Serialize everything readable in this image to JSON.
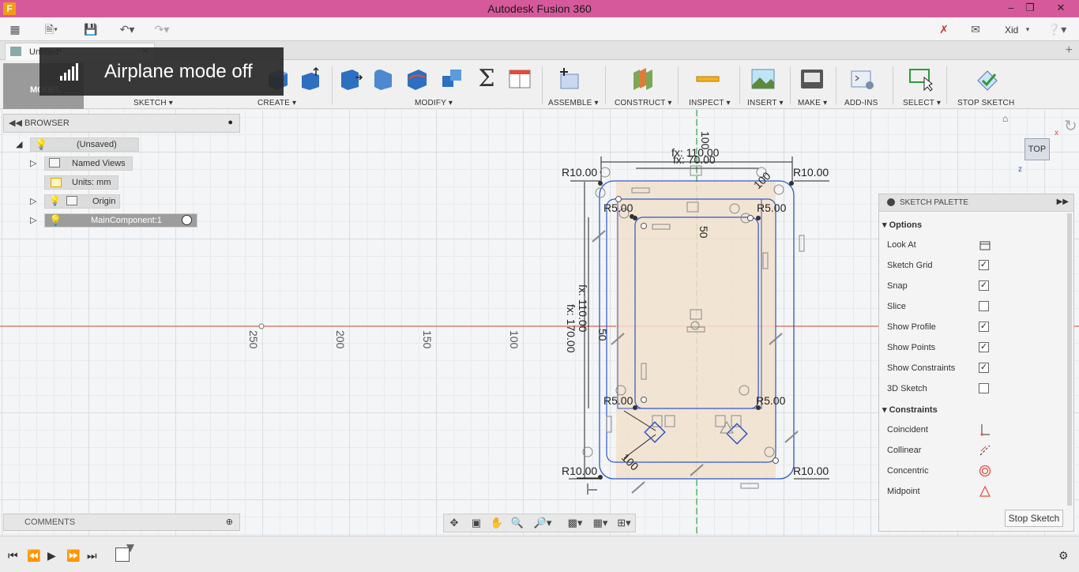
{
  "window": {
    "title": "Autodesk Fusion 360",
    "icon_letter": "F"
  },
  "appbar": {
    "user": "Xid"
  },
  "tab": {
    "name": "Untitled*"
  },
  "toast": {
    "text": "Airplane mode off"
  },
  "workspace": {
    "label": "MODEL"
  },
  "toolbar": {
    "groups": [
      "SKETCH ▾",
      "CREATE ▾",
      "MODIFY ▾",
      "ASSEMBLE ▾",
      "CONSTRUCT ▾",
      "INSPECT ▾",
      "INSERT ▾",
      "MAKE ▾",
      "ADD-INS",
      "SELECT ▾",
      "STOP SKETCH"
    ]
  },
  "browser": {
    "title": "BROWSER",
    "items": [
      {
        "label": "(Unsaved)"
      },
      {
        "label": "Named Views"
      },
      {
        "label": "Units: mm"
      },
      {
        "label": "Origin"
      },
      {
        "label": "MainComponent:1"
      }
    ]
  },
  "comments": {
    "title": "COMMENTS"
  },
  "viewcube": {
    "label": "TOP"
  },
  "sketch": {
    "dims": {
      "fx110_top": "fx: 110.00",
      "fx70_top": "fx: 70.00",
      "fx110_side": "fx: 110.00",
      "fx170_side": "fx: 170.00",
      "r10_tl": "R10.00",
      "r10_tr": "R10.00",
      "r10_bl": "R10.00",
      "r10_br": "R10.00",
      "r5_tl": "R5.00",
      "r5_tr": "R5.00",
      "r5_bl": "R5.00",
      "r5_br": "R5.00",
      "d100v": "100",
      "d50a": "50",
      "d50b": "50",
      "d100diag": "100",
      "d100diag2": "100"
    },
    "ruler": [
      "250",
      "200",
      "150",
      "100"
    ]
  },
  "palette": {
    "title": "SKETCH PALETTE",
    "options_title": "Options",
    "options": [
      {
        "label": "Look At",
        "type": "icon"
      },
      {
        "label": "Sketch Grid",
        "checked": true
      },
      {
        "label": "Snap",
        "checked": true
      },
      {
        "label": "Slice",
        "checked": false
      },
      {
        "label": "Show Profile",
        "checked": true
      },
      {
        "label": "Show Points",
        "checked": true
      },
      {
        "label": "Show Constraints",
        "checked": true
      },
      {
        "label": "3D Sketch",
        "checked": false
      }
    ],
    "constraints_title": "Constraints",
    "constraints": [
      {
        "label": "Coincident"
      },
      {
        "label": "Collinear"
      },
      {
        "label": "Concentric"
      },
      {
        "label": "Midpoint"
      }
    ],
    "stop_label": "Stop Sketch"
  }
}
